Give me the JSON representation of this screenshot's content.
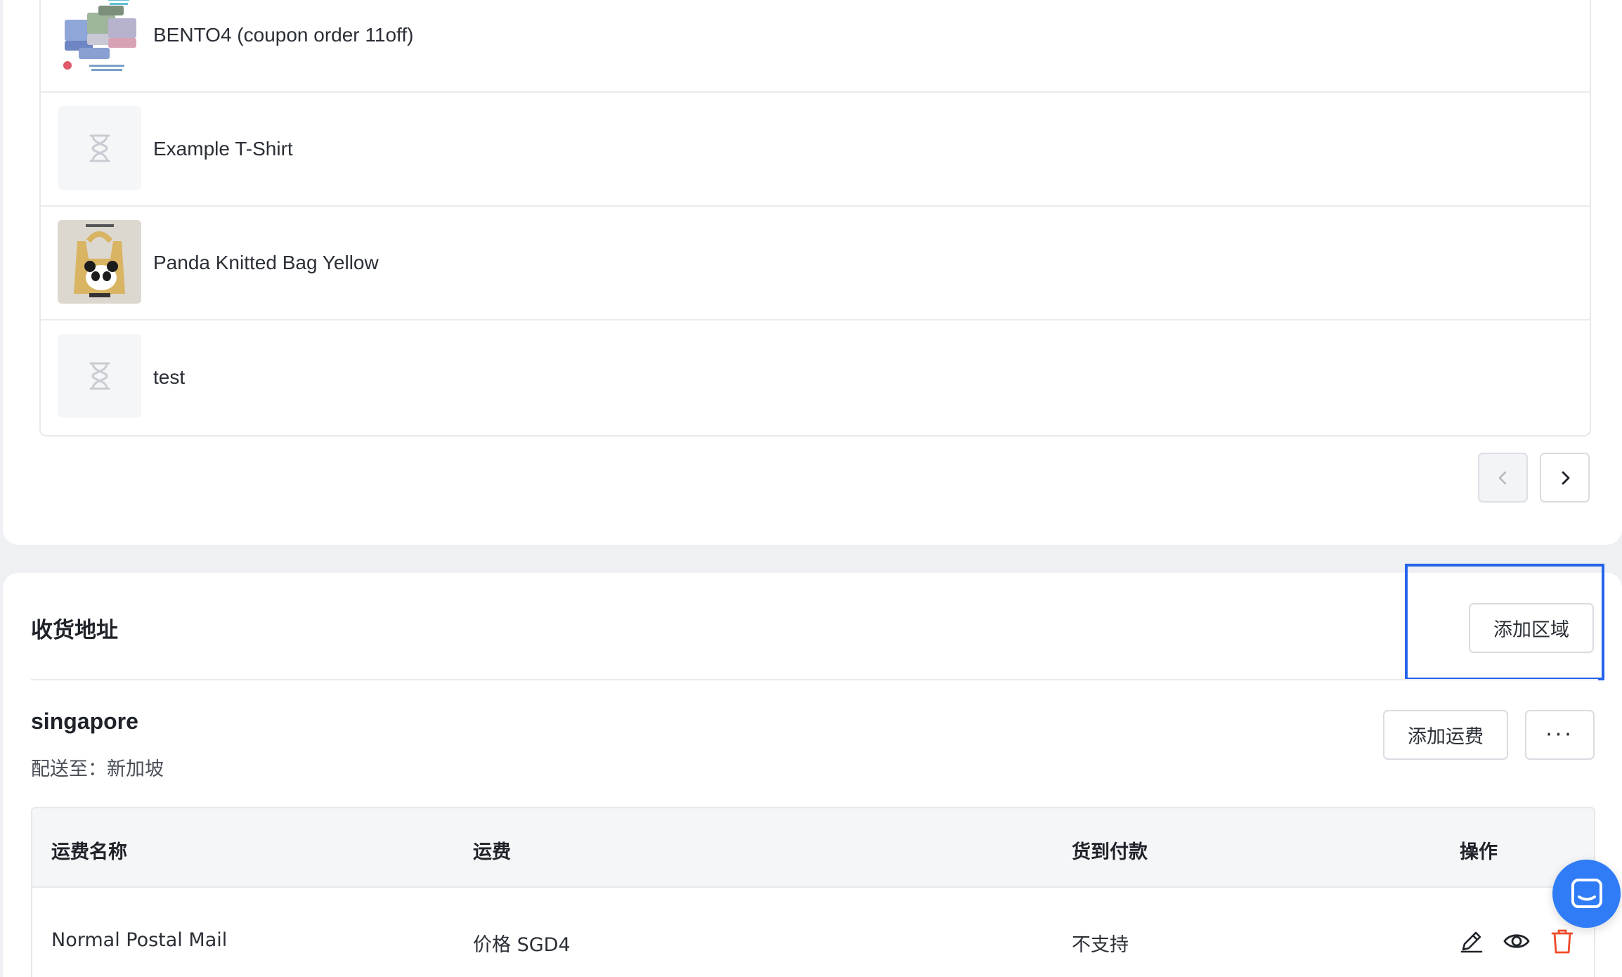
{
  "products": [
    {
      "name": "BENTO4 (coupon order 11off)",
      "image": "bento-box-image"
    },
    {
      "name": "Example T-Shirt",
      "image": "placeholder-hourglass-icon"
    },
    {
      "name": "Panda Knitted Bag Yellow",
      "image": "panda-bag-image"
    },
    {
      "name": "test",
      "image": "placeholder-hourglass-icon"
    }
  ],
  "pagination": {
    "prev_icon": "chevron-left-icon",
    "next_icon": "chevron-right-icon"
  },
  "shipping": {
    "title": "收货地址",
    "add_region_label": "添加区域",
    "zone": {
      "name": "singapore",
      "deliver_to": "配送至：新加坡",
      "add_rate_label": "添加运费",
      "more_label": "···"
    },
    "table": {
      "headers": {
        "name": "运费名称",
        "rate": "运费",
        "cod": "货到付款",
        "actions": "操作"
      },
      "rows": [
        {
          "name": "Normal Postal Mail",
          "rate": "价格 SGD4",
          "cod": "不支持"
        }
      ]
    }
  },
  "colors": {
    "highlight": "#2563eb",
    "delete": "#ef4b2b",
    "chat": "#2f7cf6"
  }
}
